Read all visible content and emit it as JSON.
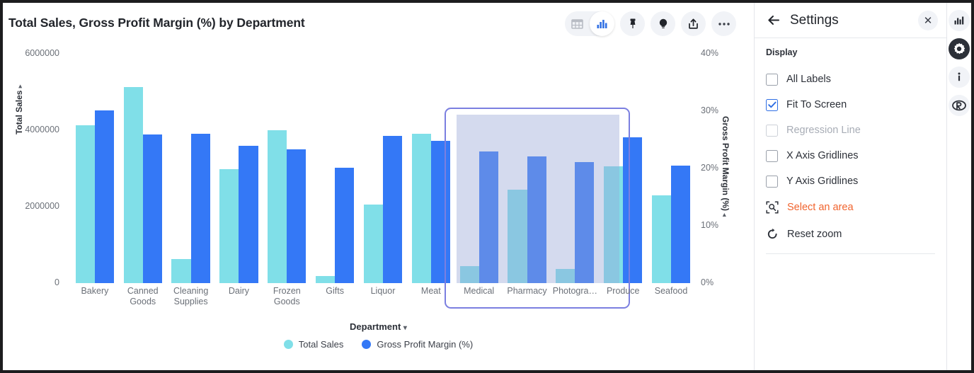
{
  "chart": {
    "title": "Total Sales, Gross Profit Margin (%) by Department",
    "toolbar": [
      {
        "name": "table-view-icon",
        "label": "Table view"
      },
      {
        "name": "chart-view-icon",
        "label": "Chart view"
      },
      {
        "name": "pin-icon",
        "label": "Pin"
      },
      {
        "name": "insights-bulb-icon",
        "label": "Insights"
      },
      {
        "name": "share-icon",
        "label": "Share"
      },
      {
        "name": "more-options-icon",
        "label": "More"
      }
    ]
  },
  "chart_data": {
    "type": "bar",
    "title": "Total Sales, Gross Profit Margin (%) by Department",
    "xlabel": "Department",
    "ylabel": "Total Sales",
    "y2label": "Gross Profit Margin (%)",
    "grid": false,
    "legend_position": "bottom",
    "ylim": [
      0,
      6000000
    ],
    "y2lim": [
      0,
      40
    ],
    "yticks": [
      "0",
      "2000000",
      "4000000",
      "6000000"
    ],
    "y2ticks": [
      "0%",
      "10%",
      "20%",
      "30%",
      "40%"
    ],
    "categories": [
      "Bakery",
      "Canned Goods",
      "Cleaning Supplies",
      "Dairy",
      "Frozen Goods",
      "Gifts",
      "Liquor",
      "Meat",
      "Medical",
      "Pharmacy",
      "Photogra…",
      "Produce",
      "Seafood"
    ],
    "series": [
      {
        "name": "Total Sales",
        "axis": "left",
        "color": "#80dfe8",
        "values": [
          4130000,
          5130000,
          630000,
          2980000,
          4000000,
          190000,
          2050000,
          3900000,
          450000,
          2450000,
          370000,
          3060000,
          2300000
        ]
      },
      {
        "name": "Gross Profit Margin (%)",
        "axis": "right",
        "color": "#3478f6",
        "values": [
          30.1,
          25.9,
          26.0,
          24.0,
          23.3,
          20.1,
          25.7,
          24.8,
          23.0,
          22.1,
          21.1,
          25.4,
          20.5
        ]
      }
    ],
    "selection": {
      "label": "Select an area",
      "categories": [
        "Medical",
        "Pharmacy",
        "Photogra…",
        "Produce"
      ],
      "border_color": "#7b7fe0",
      "fill_color": "#ccd4ea"
    },
    "annotations": []
  },
  "settings": {
    "back_icon": "back-arrow-icon",
    "title": "Settings",
    "close_icon": "close-icon",
    "section_heading": "Display",
    "checkboxes": [
      {
        "label": "All Labels",
        "checked": false,
        "disabled": false
      },
      {
        "label": "Fit To Screen",
        "checked": true,
        "disabled": false
      },
      {
        "label": "Regression Line",
        "checked": false,
        "disabled": true
      },
      {
        "label": "X Axis Gridlines",
        "checked": false,
        "disabled": false
      },
      {
        "label": "Y Axis Gridlines",
        "checked": false,
        "disabled": false
      }
    ],
    "actions": [
      {
        "label": "Select an area",
        "icon": "select-area-icon",
        "accent": true
      },
      {
        "label": "Reset zoom",
        "icon": "reset-zoom-icon",
        "accent": false
      }
    ],
    "accent_color": "#f1642e",
    "checked_color": "#2f6fe4"
  },
  "rail": [
    {
      "name": "rail-chart-icon",
      "label": "Chart",
      "active": false
    },
    {
      "name": "rail-settings-gear-icon",
      "label": "Settings",
      "active": true
    },
    {
      "name": "rail-info-icon",
      "label": "Info",
      "active": false
    },
    {
      "name": "rail-r-icon",
      "label": "R",
      "active": false
    }
  ]
}
